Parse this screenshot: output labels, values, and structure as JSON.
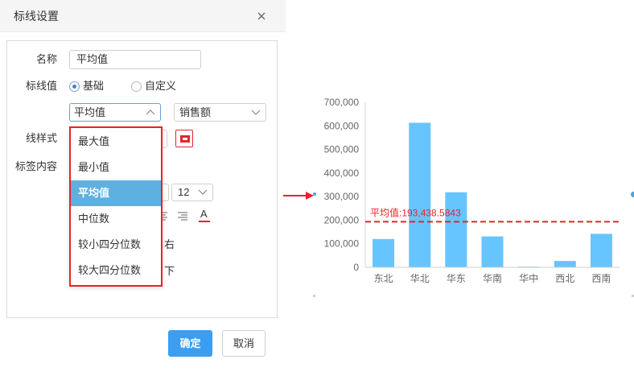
{
  "dialog": {
    "title": "标线设置",
    "form": {
      "name": {
        "label": "名称",
        "value": "平均值"
      },
      "line_value": {
        "label": "标线值",
        "options": [
          {
            "label": "基础",
            "checked": true
          },
          {
            "label": "自定义",
            "checked": false
          }
        ],
        "stat_select": {
          "value": "平均值",
          "open": true
        },
        "field_select": {
          "value": "销售额"
        }
      },
      "line_style": {
        "label": "线样式",
        "color": "#e8232b"
      },
      "label_content": {
        "label": "标签内容",
        "font_size": "12",
        "font_color_glyph": "A",
        "font_color": "#e8232b",
        "horizontal_position": "右",
        "vertical_position": "下"
      }
    },
    "dropdown": {
      "options": [
        "最大值",
        "最小值",
        "平均值",
        "中位数",
        "较小四分位数",
        "较大四分位数"
      ],
      "selected_index": 2
    },
    "footer": {
      "confirm_label": "确定",
      "cancel_label": "取消"
    }
  },
  "icons": {
    "close": "close-icon",
    "select_open": "chevron-up-icon",
    "select_closed": "chevron-down-icon",
    "align_center": "align-center-icon",
    "align_right": "align-right-icon",
    "font_color": "font-color-icon",
    "annotation_arrow": "arrow-right-icon"
  },
  "colors": {
    "primary": "#3c9ef0",
    "dropdown_selected_bg": "#5eb0e0",
    "annotation_red": "#e8232b",
    "bar": "#66c5ff"
  },
  "chart_data": {
    "type": "bar",
    "categories": [
      "东北",
      "华北",
      "华东",
      "华南",
      "华中",
      "西北",
      "西南"
    ],
    "values": [
      120000,
      613000,
      318000,
      131000,
      3000,
      27000,
      142000
    ],
    "ylim": [
      0,
      700000
    ],
    "yticks": [
      0,
      100000,
      200000,
      300000,
      400000,
      500000,
      600000,
      700000
    ],
    "grid": false,
    "bar_color": "#66c5ff",
    "reference_line": {
      "label": "平均值:193,438.5843",
      "value": 193438.5843,
      "style": "dashed",
      "color": "#e8232b"
    }
  }
}
